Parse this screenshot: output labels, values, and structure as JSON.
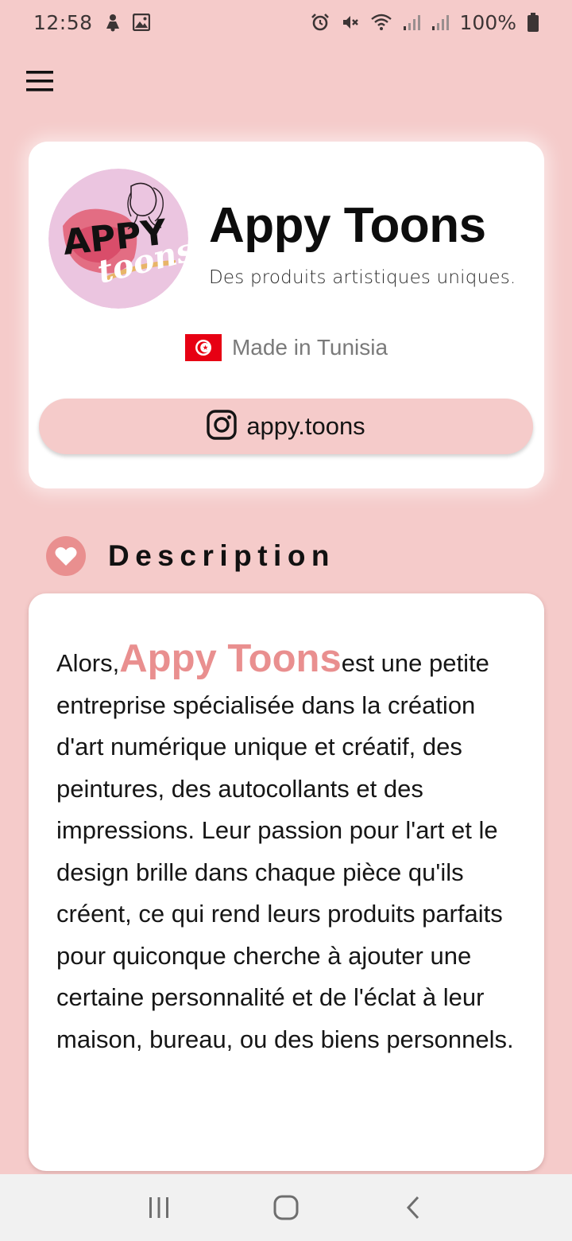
{
  "status_bar": {
    "time": "12:58",
    "battery_percent": "100%",
    "left_icons": [
      "notification-icon",
      "image-icon"
    ],
    "right_icons": [
      "alarm-icon",
      "mute-icon",
      "wifi-icon",
      "signal-icon",
      "signal-icon",
      "battery-icon"
    ]
  },
  "header": {
    "menu_icon": "hamburger-menu-icon"
  },
  "profile": {
    "title": "Appy Toons",
    "subtitle": "Des produits artistiques uniques.",
    "origin": "Made in Tunisia",
    "origin_flag": "tunisia-flag-icon",
    "instagram_handle": "appy.toons",
    "logo_text_main": "APPY",
    "logo_text_script": "toons"
  },
  "description": {
    "heading": "Description",
    "lead": "Alors,",
    "brand": "Appy Toons",
    "body": "est une petite entreprise spécialisée dans la création d'art numérique unique et créatif, des peintures, des autocollants et des impressions. Leur passion pour l'art et le design brille dans chaque pièce qu'ils créent, ce qui rend leurs produits parfaits pour quiconque cherche à ajouter une certaine personnalité et de l'éclat à leur maison, bureau, ou des biens personnels."
  },
  "colors": {
    "background": "#f5cbca",
    "accent": "#e98f8f",
    "card": "#ffffff",
    "nav_bar": "#f1f1f1"
  },
  "nav_bar": {
    "buttons": [
      "recent-apps-icon",
      "home-icon",
      "back-icon"
    ]
  }
}
